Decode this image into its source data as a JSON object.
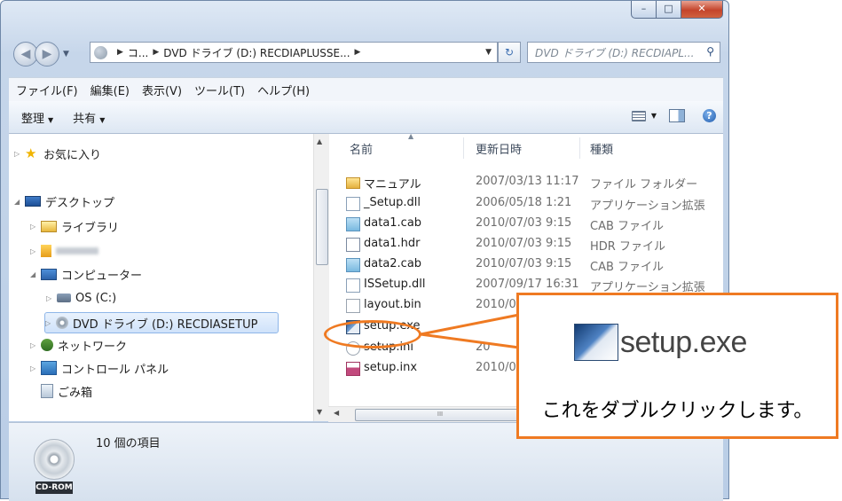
{
  "window": {
    "controls": {
      "minimize": "–",
      "maximize": "□",
      "close": "✕"
    }
  },
  "address_bar": {
    "segments": [
      "コ...",
      "DVD ドライブ (D:) RECDIAPLUSSE..."
    ],
    "search_placeholder": "DVD ドライブ (D:) RECDIAPL..."
  },
  "menubar": [
    "ファイル(F)",
    "編集(E)",
    "表示(V)",
    "ツール(T)",
    "ヘルプ(H)"
  ],
  "toolbar": {
    "organize": "整理",
    "share": "共有"
  },
  "sidebar": {
    "items": [
      {
        "label": "お気に入り",
        "icon": "star-icon"
      },
      {
        "label": "デスクトップ",
        "icon": "desktop-icon"
      },
      {
        "label": "ライブラリ",
        "icon": "library-icon"
      },
      {
        "label": "",
        "icon": "user-folder-icon"
      },
      {
        "label": "コンピューター",
        "icon": "computer-icon"
      },
      {
        "label": "OS (C:)",
        "icon": "drive-icon"
      },
      {
        "label": "DVD ドライブ (D:) RECDIASETUP",
        "icon": "dvd-icon",
        "selected": true
      },
      {
        "label": "ネットワーク",
        "icon": "network-icon"
      },
      {
        "label": "コントロール パネル",
        "icon": "control-panel-icon"
      },
      {
        "label": "ごみ箱",
        "icon": "recycle-bin-icon"
      }
    ]
  },
  "file_list": {
    "columns": [
      "名前",
      "更新日時",
      "種類"
    ],
    "rows": [
      {
        "name": "マニュアル",
        "date": "2007/03/13 11:17",
        "type": "ファイル フォルダー",
        "icon": "folder-icon"
      },
      {
        "name": "_Setup.dll",
        "date": "2006/05/18 1:21",
        "type": "アプリケーション拡張",
        "icon": "dll-icon"
      },
      {
        "name": "data1.cab",
        "date": "2010/07/03 9:15",
        "type": "CAB ファイル",
        "icon": "cab-icon"
      },
      {
        "name": "data1.hdr",
        "date": "2010/07/03 9:15",
        "type": "HDR ファイル",
        "icon": "hdr-icon"
      },
      {
        "name": "data2.cab",
        "date": "2010/07/03 9:15",
        "type": "CAB ファイル",
        "icon": "cab-icon"
      },
      {
        "name": "ISSetup.dll",
        "date": "2007/09/17 16:31",
        "type": "アプリケーション拡張",
        "icon": "dll-icon"
      },
      {
        "name": "layout.bin",
        "date": "2010/0",
        "type": "",
        "icon": "bin-icon"
      },
      {
        "name": "setup.exe",
        "date": "",
        "type": "",
        "icon": "exe-icon"
      },
      {
        "name": "setup.ini",
        "date": "20",
        "type": "",
        "icon": "ini-icon"
      },
      {
        "name": "setup.inx",
        "date": "2010/0",
        "type": "",
        "icon": "inx-icon"
      }
    ]
  },
  "status": {
    "item_count": "10 個の項目",
    "drive_label": "CD-ROM"
  },
  "callout": {
    "filename": "setup.exe",
    "instruction": "これをダブルクリックします。",
    "color": "#ef7a22"
  }
}
